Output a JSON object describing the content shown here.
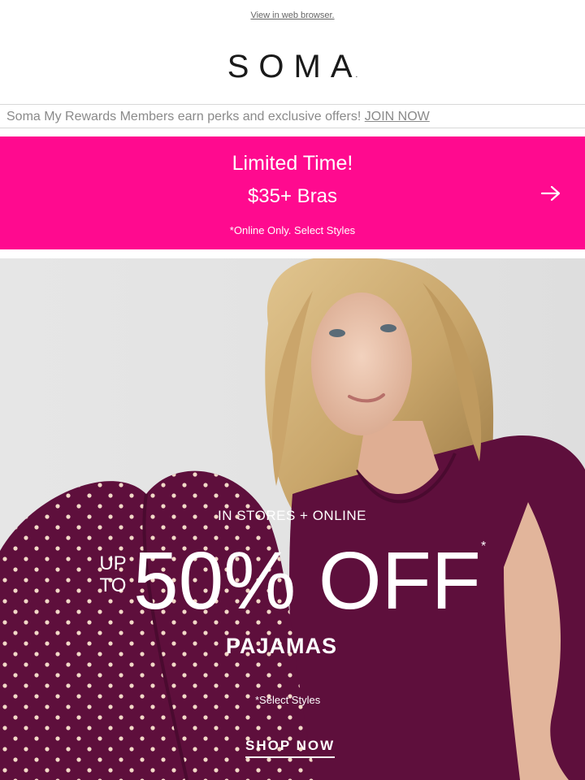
{
  "header": {
    "view_in_browser": "View in web browser.",
    "brand_logo": "SOMA",
    "brand_logo_mark": "."
  },
  "rewards_bar": {
    "text": "Soma My Rewards Members earn perks and exclusive offers!",
    "join_label": "JOIN NOW"
  },
  "promo_banner": {
    "title": "Limited Time!",
    "subtitle": "$35+ Bras",
    "fine_print": "*Online Only. Select Styles",
    "background_color": "#ff0a8f",
    "arrow_icon": "arrow-right-icon"
  },
  "hero": {
    "kicker": "IN STORES + ONLINE",
    "up_to_line1": "UP",
    "up_to_line2": "TO",
    "discount": "50% OFF",
    "asterisk": "*",
    "category": "PAJAMAS",
    "fine_print": "*Select Styles",
    "cta_label": "SHOP NOW",
    "product_color": "#5e0f3c"
  }
}
